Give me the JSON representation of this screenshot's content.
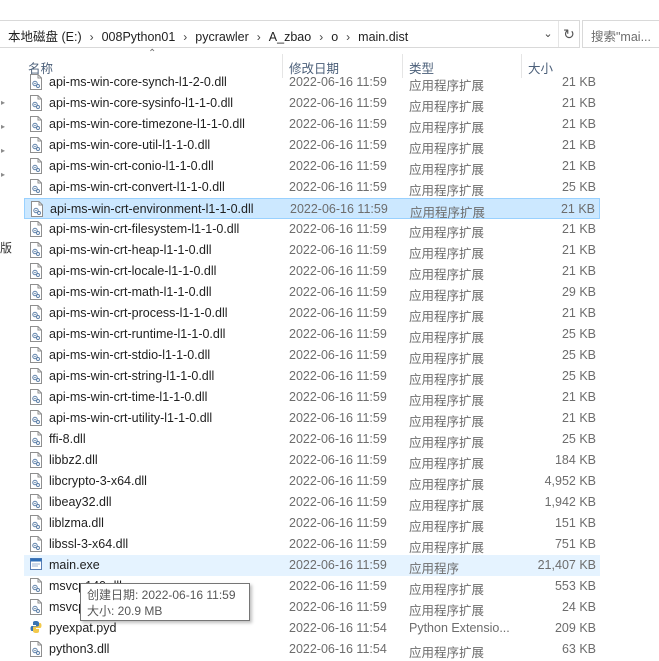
{
  "address": {
    "crumbs": [
      "本地磁盘 (E:)",
      "008Python01",
      "pycrawler",
      "A_zbao",
      "o",
      "main.dist"
    ],
    "separator": "›",
    "dropdown_icon": "chevron-down-icon",
    "refresh_icon": "refresh-icon"
  },
  "search": {
    "placeholder": "搜索\"mai..."
  },
  "nav": {
    "glyph": "版"
  },
  "columns": {
    "name": "名称",
    "date": "修改日期",
    "type": "类型",
    "size": "大小"
  },
  "files": [
    {
      "name": "api-ms-win-core-synch-l1-2-0.dll",
      "date": "2022-06-16 11:59",
      "type": "应用程序扩展",
      "size": "21 KB",
      "kind": "dll"
    },
    {
      "name": "api-ms-win-core-sysinfo-l1-1-0.dll",
      "date": "2022-06-16 11:59",
      "type": "应用程序扩展",
      "size": "21 KB",
      "kind": "dll"
    },
    {
      "name": "api-ms-win-core-timezone-l1-1-0.dll",
      "date": "2022-06-16 11:59",
      "type": "应用程序扩展",
      "size": "21 KB",
      "kind": "dll"
    },
    {
      "name": "api-ms-win-core-util-l1-1-0.dll",
      "date": "2022-06-16 11:59",
      "type": "应用程序扩展",
      "size": "21 KB",
      "kind": "dll"
    },
    {
      "name": "api-ms-win-crt-conio-l1-1-0.dll",
      "date": "2022-06-16 11:59",
      "type": "应用程序扩展",
      "size": "21 KB",
      "kind": "dll"
    },
    {
      "name": "api-ms-win-crt-convert-l1-1-0.dll",
      "date": "2022-06-16 11:59",
      "type": "应用程序扩展",
      "size": "25 KB",
      "kind": "dll"
    },
    {
      "name": "api-ms-win-crt-environment-l1-1-0.dll",
      "date": "2022-06-16 11:59",
      "type": "应用程序扩展",
      "size": "21 KB",
      "kind": "dll",
      "state": "selected"
    },
    {
      "name": "api-ms-win-crt-filesystem-l1-1-0.dll",
      "date": "2022-06-16 11:59",
      "type": "应用程序扩展",
      "size": "21 KB",
      "kind": "dll"
    },
    {
      "name": "api-ms-win-crt-heap-l1-1-0.dll",
      "date": "2022-06-16 11:59",
      "type": "应用程序扩展",
      "size": "21 KB",
      "kind": "dll"
    },
    {
      "name": "api-ms-win-crt-locale-l1-1-0.dll",
      "date": "2022-06-16 11:59",
      "type": "应用程序扩展",
      "size": "21 KB",
      "kind": "dll"
    },
    {
      "name": "api-ms-win-crt-math-l1-1-0.dll",
      "date": "2022-06-16 11:59",
      "type": "应用程序扩展",
      "size": "29 KB",
      "kind": "dll"
    },
    {
      "name": "api-ms-win-crt-process-l1-1-0.dll",
      "date": "2022-06-16 11:59",
      "type": "应用程序扩展",
      "size": "21 KB",
      "kind": "dll"
    },
    {
      "name": "api-ms-win-crt-runtime-l1-1-0.dll",
      "date": "2022-06-16 11:59",
      "type": "应用程序扩展",
      "size": "25 KB",
      "kind": "dll"
    },
    {
      "name": "api-ms-win-crt-stdio-l1-1-0.dll",
      "date": "2022-06-16 11:59",
      "type": "应用程序扩展",
      "size": "25 KB",
      "kind": "dll"
    },
    {
      "name": "api-ms-win-crt-string-l1-1-0.dll",
      "date": "2022-06-16 11:59",
      "type": "应用程序扩展",
      "size": "25 KB",
      "kind": "dll"
    },
    {
      "name": "api-ms-win-crt-time-l1-1-0.dll",
      "date": "2022-06-16 11:59",
      "type": "应用程序扩展",
      "size": "21 KB",
      "kind": "dll"
    },
    {
      "name": "api-ms-win-crt-utility-l1-1-0.dll",
      "date": "2022-06-16 11:59",
      "type": "应用程序扩展",
      "size": "21 KB",
      "kind": "dll"
    },
    {
      "name": "ffi-8.dll",
      "date": "2022-06-16 11:59",
      "type": "应用程序扩展",
      "size": "25 KB",
      "kind": "dll"
    },
    {
      "name": "libbz2.dll",
      "date": "2022-06-16 11:59",
      "type": "应用程序扩展",
      "size": "184 KB",
      "kind": "dll"
    },
    {
      "name": "libcrypto-3-x64.dll",
      "date": "2022-06-16 11:59",
      "type": "应用程序扩展",
      "size": "4,952 KB",
      "kind": "dll"
    },
    {
      "name": "libeay32.dll",
      "date": "2022-06-16 11:59",
      "type": "应用程序扩展",
      "size": "1,942 KB",
      "kind": "dll"
    },
    {
      "name": "liblzma.dll",
      "date": "2022-06-16 11:59",
      "type": "应用程序扩展",
      "size": "151 KB",
      "kind": "dll"
    },
    {
      "name": "libssl-3-x64.dll",
      "date": "2022-06-16 11:59",
      "type": "应用程序扩展",
      "size": "751 KB",
      "kind": "dll"
    },
    {
      "name": "main.exe",
      "date": "2022-06-16 11:59",
      "type": "应用程序",
      "size": "21,407 KB",
      "kind": "exe",
      "state": "hover"
    },
    {
      "name": "msvcp140.dll",
      "date": "2022-06-16 11:59",
      "type": "应用程序扩展",
      "size": "553 KB",
      "kind": "dll"
    },
    {
      "name": "msvcp140_1.dll",
      "date": "2022-06-16 11:59",
      "type": "应用程序扩展",
      "size": "24 KB",
      "kind": "dll"
    },
    {
      "name": "pyexpat.pyd",
      "date": "2022-06-16 11:54",
      "type": "Python Extensio...",
      "size": "209 KB",
      "kind": "pyd"
    },
    {
      "name": "python3.dll",
      "date": "2022-06-16 11:54",
      "type": "应用程序扩展",
      "size": "63 KB",
      "kind": "dll"
    }
  ],
  "tooltip": {
    "created": "创建日期: 2022-06-16 11:59",
    "size": "大小: 20.9 MB"
  },
  "colors": {
    "selected_bg": "#cce8ff",
    "hover_bg": "#e5f3ff",
    "header_text": "#4c607a"
  }
}
